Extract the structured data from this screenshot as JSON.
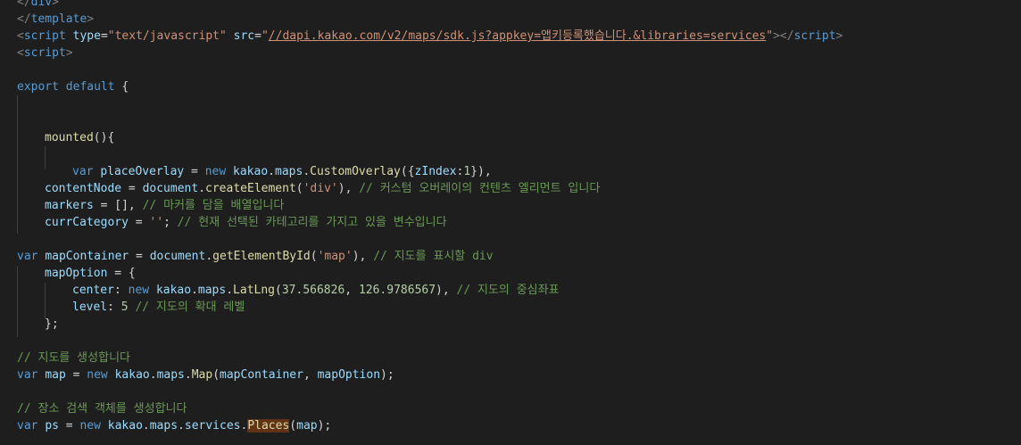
{
  "editor": {
    "lines": {
      "l1": {
        "a": "</",
        "b": "div",
        "c": ">"
      },
      "l2": {
        "a": "</",
        "b": "template",
        "c": ">"
      },
      "l3": {
        "a": "<",
        "b": "script",
        "c": " ",
        "d": "type",
        "e": "=",
        "f": "\"text/javascript\"",
        "g": " ",
        "h": "src",
        "i": "=",
        "j": "\"",
        "k": "//dapi.kakao.com/v2/maps/sdk.js?appkey=앱키등록했습니다.&libraries=services",
        "l": "\"",
        "m": "></",
        "n": "script",
        "o": ">"
      },
      "l4": {
        "a": "<",
        "b": "script",
        "c": ">"
      },
      "l6": {
        "a": "export",
        "b": " ",
        "c": "default",
        "d": " {"
      },
      "l9": {
        "a": "mounted",
        "b": "(){"
      },
      "l11": {
        "a": "var",
        "b": " ",
        "c": "placeOverlay",
        "d": " = ",
        "e": "new",
        "f": " ",
        "g": "kakao",
        "h": ".",
        "i": "maps",
        "j": ".",
        "k": "CustomOverlay",
        "l": "({",
        "m": "zIndex",
        "n": ":",
        "o": "1",
        "p": "}),"
      },
      "l12": {
        "a": "contentNode",
        "b": " = ",
        "c": "document",
        "d": ".",
        "e": "createElement",
        "f": "(",
        "g": "'div'",
        "h": "), ",
        "i": "// 커스텀 오버레이의 컨텐츠 엘리먼트 입니다"
      },
      "l13": {
        "a": "markers",
        "b": " = [], ",
        "c": "// 마커를 담을 배열입니다"
      },
      "l14": {
        "a": "currCategory",
        "b": " = ",
        "c": "''",
        "d": "; ",
        "e": "// 현재 선택된 카테고리를 가지고 있을 변수입니다"
      },
      "l16": {
        "a": "var",
        "b": " ",
        "c": "mapContainer",
        "d": " = ",
        "e": "document",
        "f": ".",
        "g": "getElementById",
        "h": "(",
        "i": "'map'",
        "j": "), ",
        "k": "// 지도를 표시할 div"
      },
      "l17": {
        "a": "mapOption",
        "b": " = {"
      },
      "l18": {
        "a": "center",
        "b": ": ",
        "c": "new",
        "d": " ",
        "e": "kakao",
        "f": ".",
        "g": "maps",
        "h": ".",
        "i": "LatLng",
        "j": "(",
        "k": "37.566826",
        "l": ", ",
        "m": "126.9786567",
        "n": "), ",
        "o": "// 지도의 중심좌표"
      },
      "l19": {
        "a": "level",
        "b": ": ",
        "c": "5",
        "d": " ",
        "e": "// 지도의 확대 레벨"
      },
      "l20": {
        "a": "};"
      },
      "l22": {
        "a": "// 지도를 생성합니다"
      },
      "l23": {
        "a": "var",
        "b": " ",
        "c": "map",
        "d": " = ",
        "e": "new",
        "f": " ",
        "g": "kakao",
        "h": ".",
        "i": "maps",
        "j": ".",
        "k": "Map",
        "l": "(",
        "m": "mapContainer",
        "n": ", ",
        "o": "mapOption",
        "p": ");"
      },
      "l25": {
        "a": "// 장소 검색 객체를 생성합니다"
      },
      "l26": {
        "a": "var",
        "b": " ",
        "c": "ps",
        "d": " = ",
        "e": "new",
        "f": " ",
        "g": "kakao",
        "h": ".",
        "i": "maps",
        "j": ".",
        "k": "services",
        "l": ".",
        "m": "Places",
        "n": "(",
        "o": "map",
        "p": ");"
      }
    }
  },
  "colors": {
    "background": "#1e1e1e",
    "keyword": "#569cd6",
    "string": "#ce9178",
    "function": "#dcdcaa",
    "variable": "#9cdcfe",
    "number": "#b5cea8",
    "comment": "#6a9955",
    "punctuation": "#d4d4d4",
    "tag-bracket": "#808080",
    "highlight": "#613214",
    "indent-guide": "#404040"
  }
}
